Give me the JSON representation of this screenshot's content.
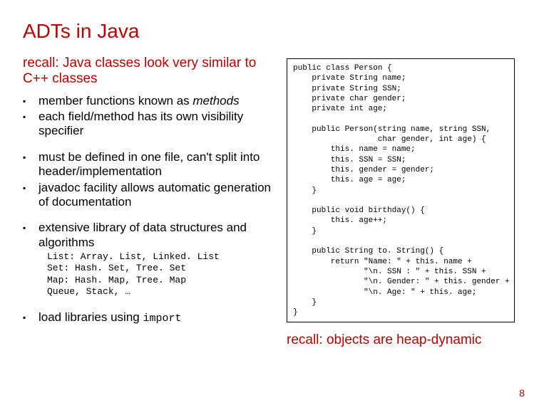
{
  "title": "ADTs in Java",
  "intro": "recall: Java classes look very similar to C++ classes",
  "bullets_a": [
    {
      "pre": "member functions known as ",
      "italic": "methods",
      "post": ""
    },
    {
      "pre": "each field/method has its own visibility specifier",
      "italic": "",
      "post": ""
    }
  ],
  "bullets_b": [
    {
      "pre": "must be defined in one file, can't split into header/implementation",
      "italic": "",
      "post": ""
    },
    {
      "pre": "javadoc facility allows automatic generation of documentation",
      "italic": "",
      "post": ""
    }
  ],
  "bullets_c": [
    {
      "pre": "extensive library of data structures and algorithms",
      "italic": "",
      "post": ""
    }
  ],
  "sub_mono": "List: Array. List, Linked. List\nSet: Hash. Set, Tree. Set\nMap: Hash. Map, Tree. Map\nQueue, Stack, …",
  "bullets_d_pre": "load libraries using ",
  "bullets_d_mono": "import",
  "code": "public class Person {\n    private String name;\n    private String SSN;\n    private char gender;\n    private int age;\n\n    public Person(string name, string SSN,\n                  char gender, int age) {\n        this. name = name;\n        this. SSN = SSN;\n        this. gender = gender;\n        this. age = age;\n    }\n\n    public void birthday() {\n        this. age++;\n    }\n\n    public String to. String() {\n        return \"Name: \" + this. name +\n               \"\\n. SSN : \" + this. SSN +\n               \"\\n. Gender: \" + this. gender +\n               \"\\n. Age: \" + this. age;\n    }\n}",
  "recall_bottom": "recall: objects are heap-dynamic",
  "page_number": "8"
}
